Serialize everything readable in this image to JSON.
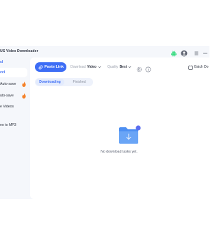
{
  "app": {
    "title": "US Video Downloader"
  },
  "titlebar": {
    "icons": [
      "android-icon",
      "avatar-icon",
      "menu-icon",
      "minimize-icon"
    ]
  },
  "sidebar": {
    "items": [
      {
        "label": "cl",
        "active": false
      },
      {
        "label": "ccl",
        "active": true
      },
      {
        "label": " Auto-save",
        "active": false,
        "hot": true
      },
      {
        "label": "uto-save",
        "active": false,
        "hot": true
      },
      {
        "label": "e Videos",
        "active": false
      },
      {
        "label": "eo to MP3",
        "active": false
      }
    ]
  },
  "toolbar": {
    "paste_label": "Paste Link",
    "download_key": "Download",
    "download_value": "Video",
    "quality_key": "Quality",
    "quality_value": "Best",
    "batch_label": "Batch Do"
  },
  "tabs": {
    "downloading": "Downloading",
    "finished": "Finished"
  },
  "empty": {
    "message": "No download tasks yet."
  },
  "colors": {
    "accent": "#3d6df5",
    "background": "#f5f7fb",
    "fire": "#f5822a",
    "android": "#3ddc84"
  }
}
